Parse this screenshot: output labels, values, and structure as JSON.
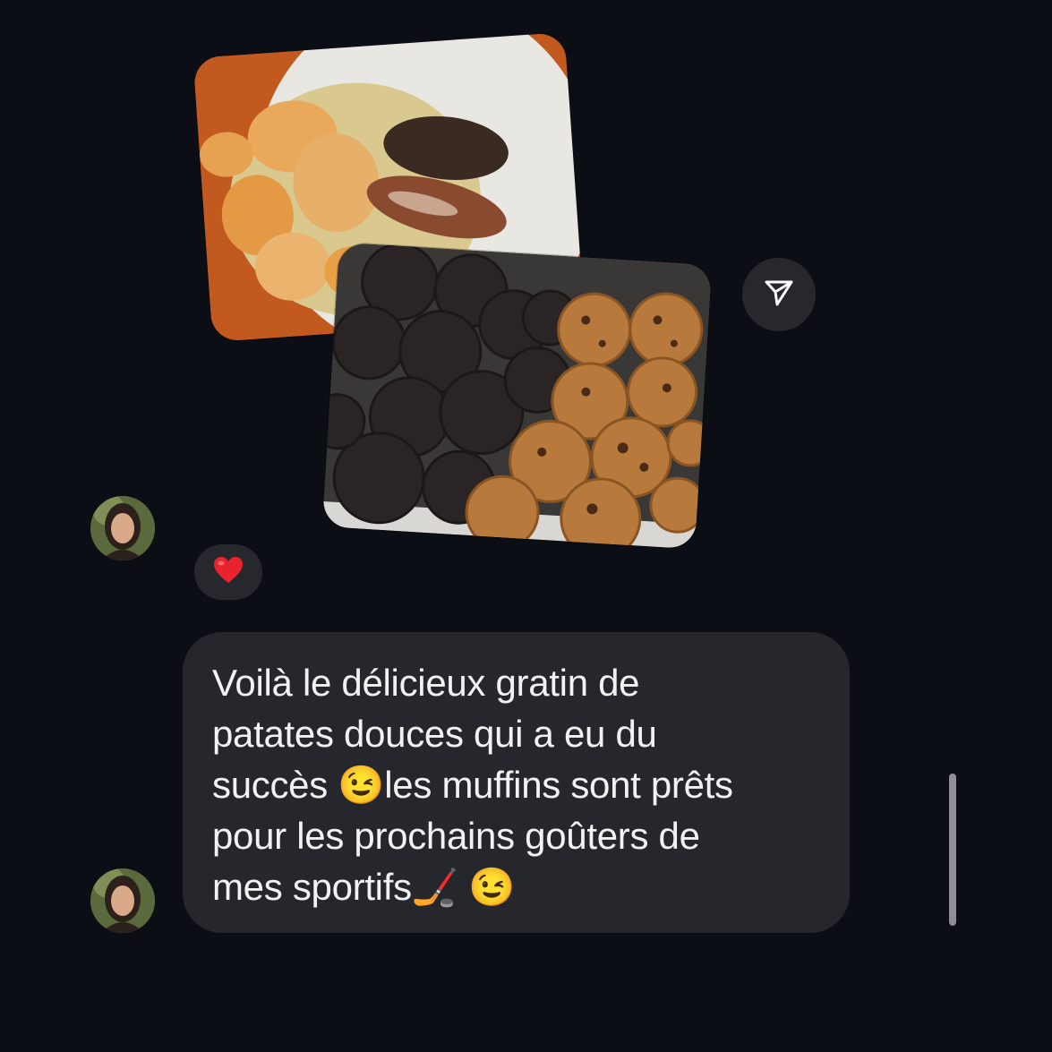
{
  "conversation": {
    "photos": [
      {
        "name": "photo-gratin-plate",
        "alt": ""
      },
      {
        "name": "photo-muffins-tray",
        "alt": ""
      }
    ],
    "share_icon": "paper-plane-icon",
    "reaction": {
      "emoji": "❤️",
      "icon": "red-heart-icon"
    },
    "message": {
      "lines": [
        "Voilà le délicieux gratin de",
        "patates douces qui a eu du",
        "succès 😉les muffins sont prêts",
        "pour les prochains goûters de",
        "mes sportifs🏒 😉"
      ]
    }
  },
  "colors": {
    "background": "#0b0e15",
    "bubble": "#25272c",
    "text": "#f2f2f2",
    "accent_heart": "#e8232e"
  }
}
